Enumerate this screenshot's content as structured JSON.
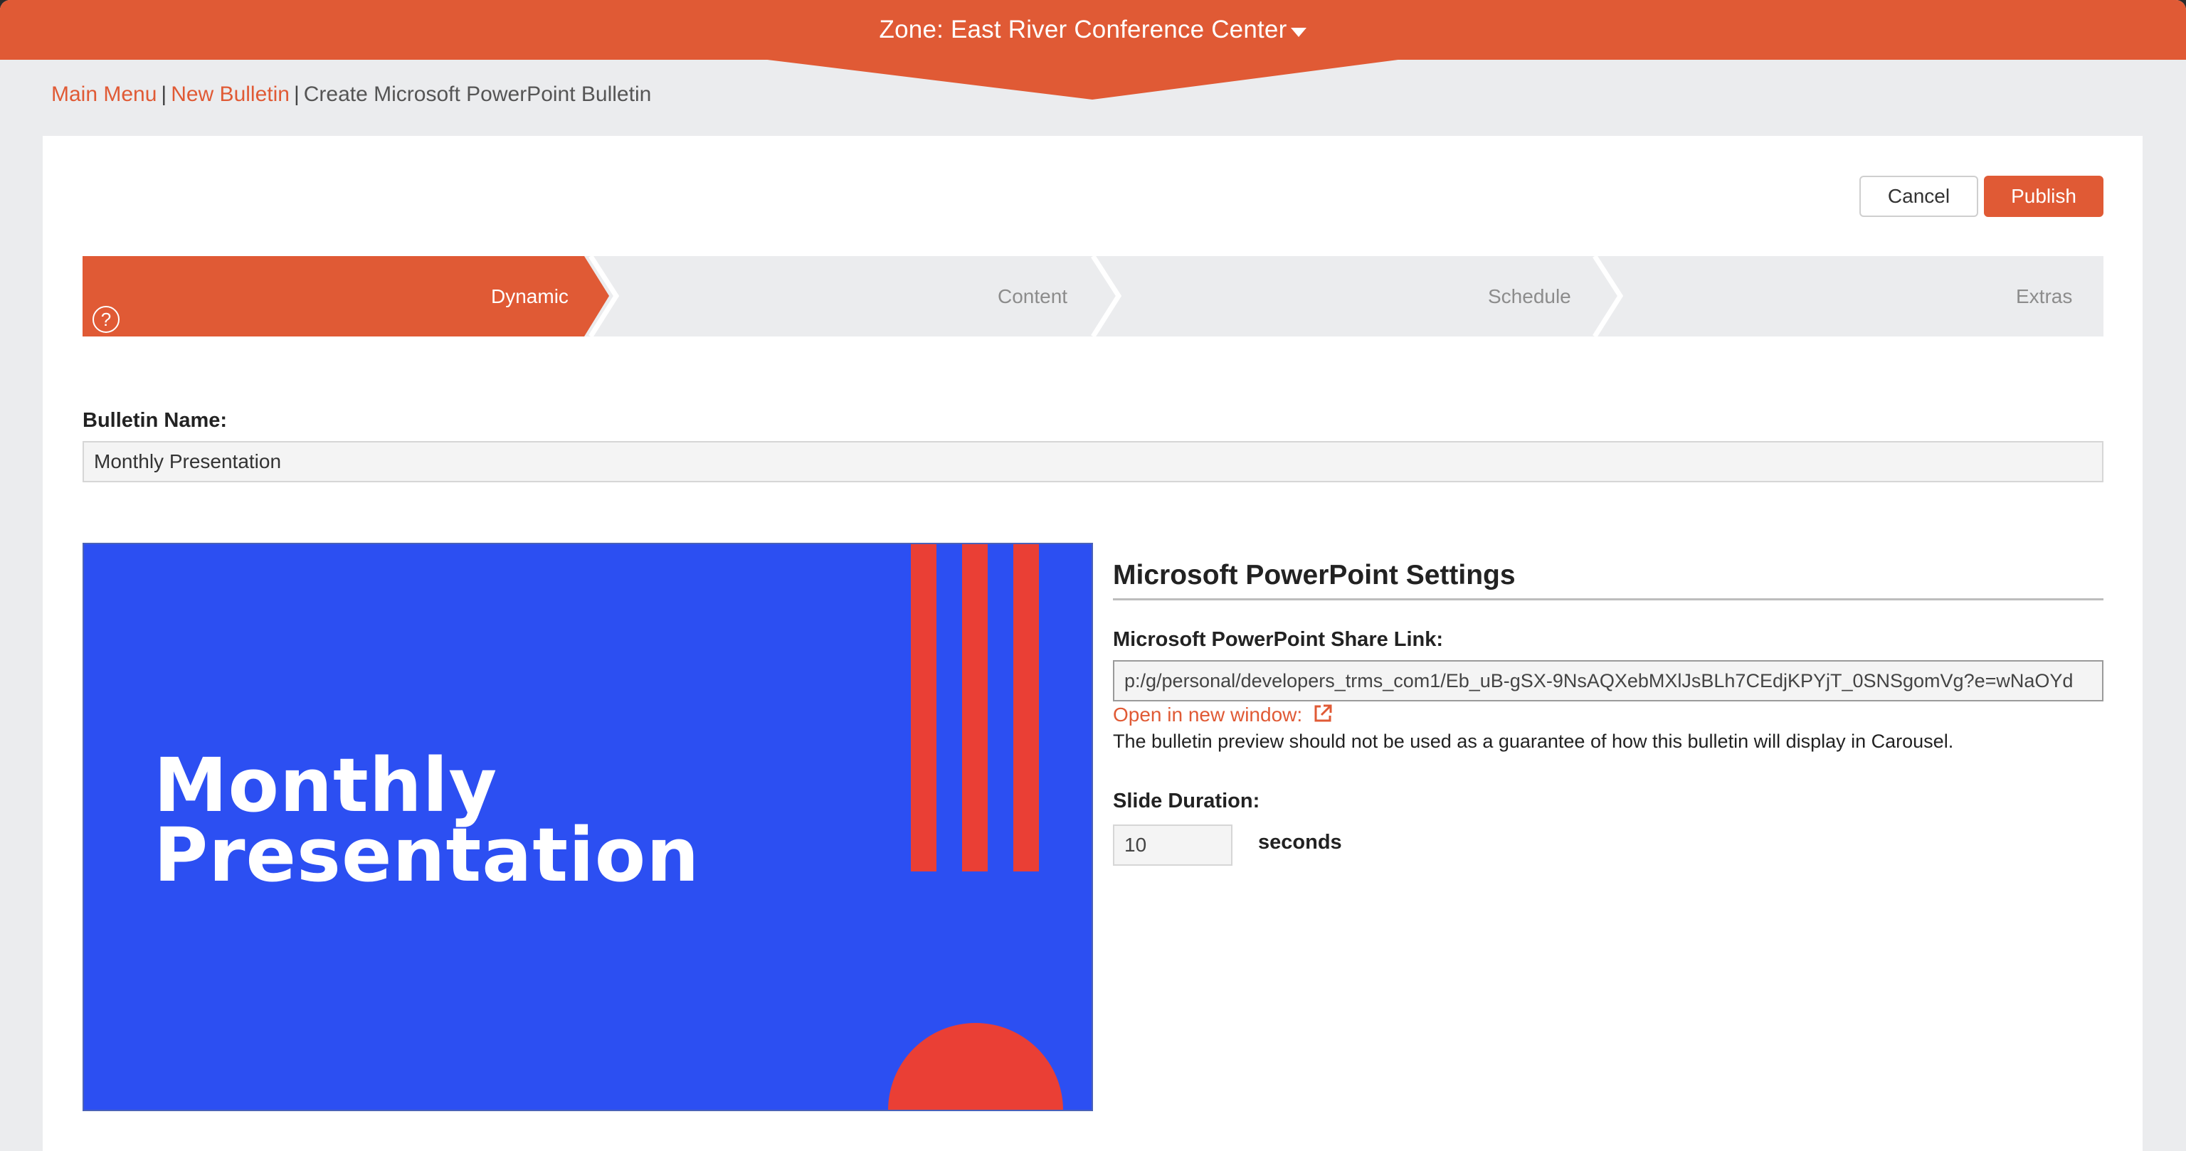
{
  "header": {
    "zone_title": "Zone: East River Conference Center",
    "caret_icon": "caret-down-icon"
  },
  "breadcrumb": {
    "main_menu": "Main Menu",
    "new_bulletin": "New Bulletin",
    "separator": "|",
    "current": "Create Microsoft PowerPoint Bulletin"
  },
  "toolbar": {
    "cancel_label": "Cancel",
    "publish_label": "Publish"
  },
  "steps": [
    {
      "label": "Dynamic",
      "active": true
    },
    {
      "label": "Content",
      "active": false
    },
    {
      "label": "Schedule",
      "active": false
    },
    {
      "label": "Extras",
      "active": false
    }
  ],
  "help_icon": "?",
  "bulletin_name": {
    "label": "Bulletin Name:",
    "value": "Monthly Presentation"
  },
  "preview": {
    "title_line1": "Monthly",
    "title_line2": "Presentation"
  },
  "settings": {
    "title": "Microsoft PowerPoint Settings",
    "share_link_label": "Microsoft PowerPoint Share Link:",
    "share_link_value": "p:/g/personal/developers_trms_com1/Eb_uB-gSX-9NsAQXebMXlJsBLh7CEdjKPYjT_0SNSgomVg?e=wNaOYd",
    "open_window_label": "Open in new window:",
    "note": "The bulletin preview should not be used as a guarantee of how this bulletin will display in Carousel.",
    "slide_duration_label": "Slide Duration:",
    "slide_duration_value": "10",
    "seconds_label": "seconds"
  },
  "colors": {
    "accent": "#e05a35",
    "slide_blue": "#2c4ff2",
    "slide_red": "#ea3f35"
  }
}
